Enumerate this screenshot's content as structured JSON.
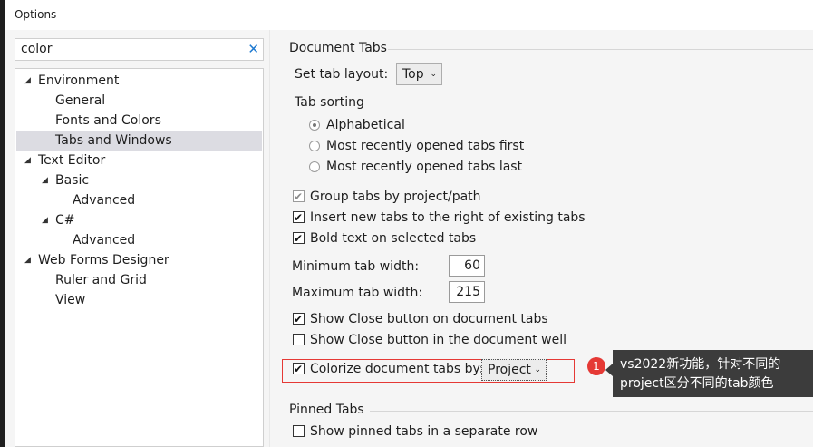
{
  "window": {
    "title": "Options"
  },
  "search": {
    "value": "color",
    "clear_icon": "close-icon"
  },
  "tree": [
    {
      "label": "Environment",
      "expanded": true
    },
    {
      "label": "General"
    },
    {
      "label": "Fonts and Colors"
    },
    {
      "label": "Tabs and Windows",
      "selected": true
    },
    {
      "label": "Text Editor",
      "expanded": true
    },
    {
      "label": "Basic",
      "expanded": true
    },
    {
      "label": "Advanced"
    },
    {
      "label": "C#",
      "expanded": true
    },
    {
      "label": "Advanced"
    },
    {
      "label": "Web Forms Designer",
      "expanded": true
    },
    {
      "label": "Ruler and Grid"
    },
    {
      "label": "View"
    }
  ],
  "document_tabs": {
    "header": "Document Tabs",
    "tab_layout_label": "Set tab layout:",
    "tab_layout_value": "Top",
    "tab_sorting_label": "Tab sorting",
    "sorting_options": [
      {
        "label": "Alphabetical",
        "checked": true
      },
      {
        "label": "Most recently opened tabs first",
        "checked": false
      },
      {
        "label": "Most recently opened tabs last",
        "checked": false
      }
    ],
    "checks": [
      {
        "label": "Group tabs by project/path",
        "checked": true,
        "disabled": true
      },
      {
        "label": "Insert new tabs to the right of existing tabs",
        "checked": true
      },
      {
        "label": "Bold text on selected tabs",
        "checked": true
      }
    ],
    "min_width_label": "Minimum tab width:",
    "min_width_value": "60",
    "max_width_label": "Maximum tab width:",
    "max_width_value": "215",
    "close_checks": [
      {
        "label": "Show Close button on document tabs",
        "checked": true
      },
      {
        "label": "Show Close button in the document well",
        "checked": false
      }
    ],
    "colorize_label": "Colorize document tabs by:",
    "colorize_checked": true,
    "colorize_value": "Project"
  },
  "pinned_tabs": {
    "header": "Pinned Tabs",
    "checks": [
      {
        "label": "Show pinned tabs in a separate row",
        "checked": false
      }
    ]
  },
  "annotation": {
    "badge": "1",
    "text": "vs2022新功能，针对不同的project区分不同的tab颜色"
  },
  "colors": {
    "highlight": "#e53935",
    "selection": "#dcdce2",
    "callout": "#3c3c3c"
  }
}
